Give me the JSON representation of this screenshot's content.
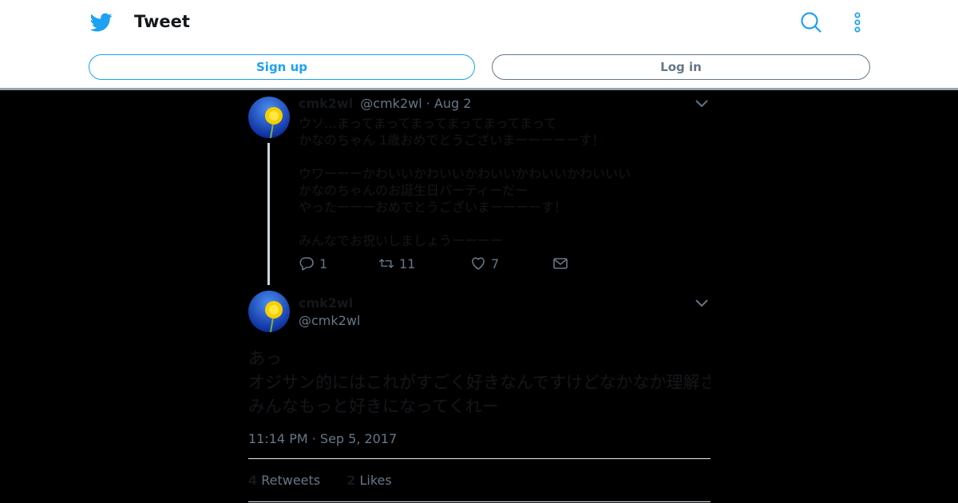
{
  "header": {
    "title": "Tweet",
    "signup_label": "Sign up",
    "login_label": "Log in",
    "brand_color": "#1da1f2"
  },
  "reply_tweet": {
    "name": "cmk2wl",
    "handle": "@cmk2wl",
    "separator": " · ",
    "date": "Aug 2",
    "lines": [
      "ウソ…まってまってまってまってまってまって",
      "かなのちゃん 1歳おめでとうございまーーーーーす！",
      "",
      "ウワーーーかわいいかわいいかわいいかわいいかわいいい",
      "かなのちゃんのお誕生日パーティーだー",
      "やったーーーおめでとうございまーーーーす！",
      "",
      "みんなでお祝いしましょうーーーー"
    ],
    "reply_count": "1",
    "retweet_count": "11",
    "like_count": "7"
  },
  "main_tweet": {
    "name": "cmk2wl",
    "handle": "@cmk2wl",
    "lines": [
      "あっ",
      "オジサン的にはこれがすごく好きなんですけどなかなか理解されなくて悲しい時があるので",
      "みんなもっと好きになってくれー"
    ],
    "timestamp": "11:14 PM · Sep 5, 2017",
    "retweets_count": "4",
    "retweets_label": "Retweets",
    "likes_count": "2",
    "likes_label": "Likes"
  }
}
